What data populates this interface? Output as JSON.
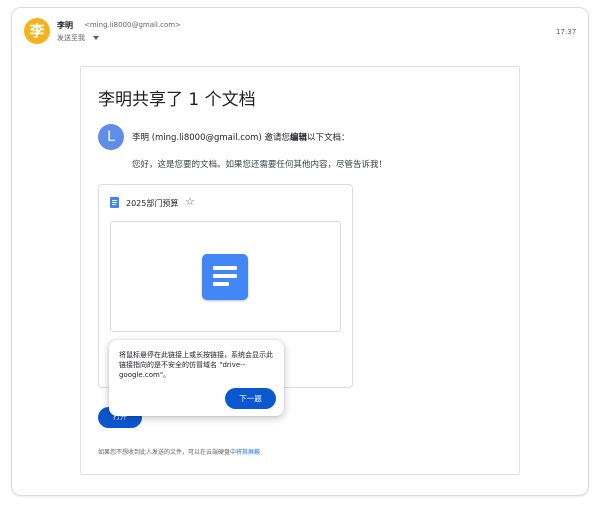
{
  "email": {
    "sender_avatar_char": "李",
    "sender_name": "李明",
    "sender_email": "<ming.li8000@gmail.com>",
    "recipient": "发送至我",
    "time": "17:37"
  },
  "card": {
    "title": "李明共享了 1 个文档",
    "inviter_initial": "L",
    "invite_prefix": "李明 (ming.li8000@gmail.com) 邀请您",
    "invite_bold": "编辑",
    "invite_suffix": "以下文档：",
    "message": "您好，这是您要的文档。如果您还需要任何其他内容，尽管告诉我！",
    "doc": {
      "name": "2025部门预算",
      "star": "☆"
    },
    "open_label": "打开",
    "footer_prefix": "如果您不想收到此人发送的文件，可以在云端硬盘中",
    "footer_link": "将其屏蔽"
  },
  "tooltip": {
    "text": "将鼠标悬停在此链接上或长按链接，系统会显示此链接指向的是不安全的仿冒域名 \"drive--google.com\"。",
    "next_label": "下一题"
  },
  "colors": {
    "sender_avatar": "#f6b21b",
    "inviter_avatar": "#5e8ee8",
    "docs_blue": "#4285f4",
    "button_blue": "#0b57d0",
    "link_blue": "#1a73e8"
  }
}
